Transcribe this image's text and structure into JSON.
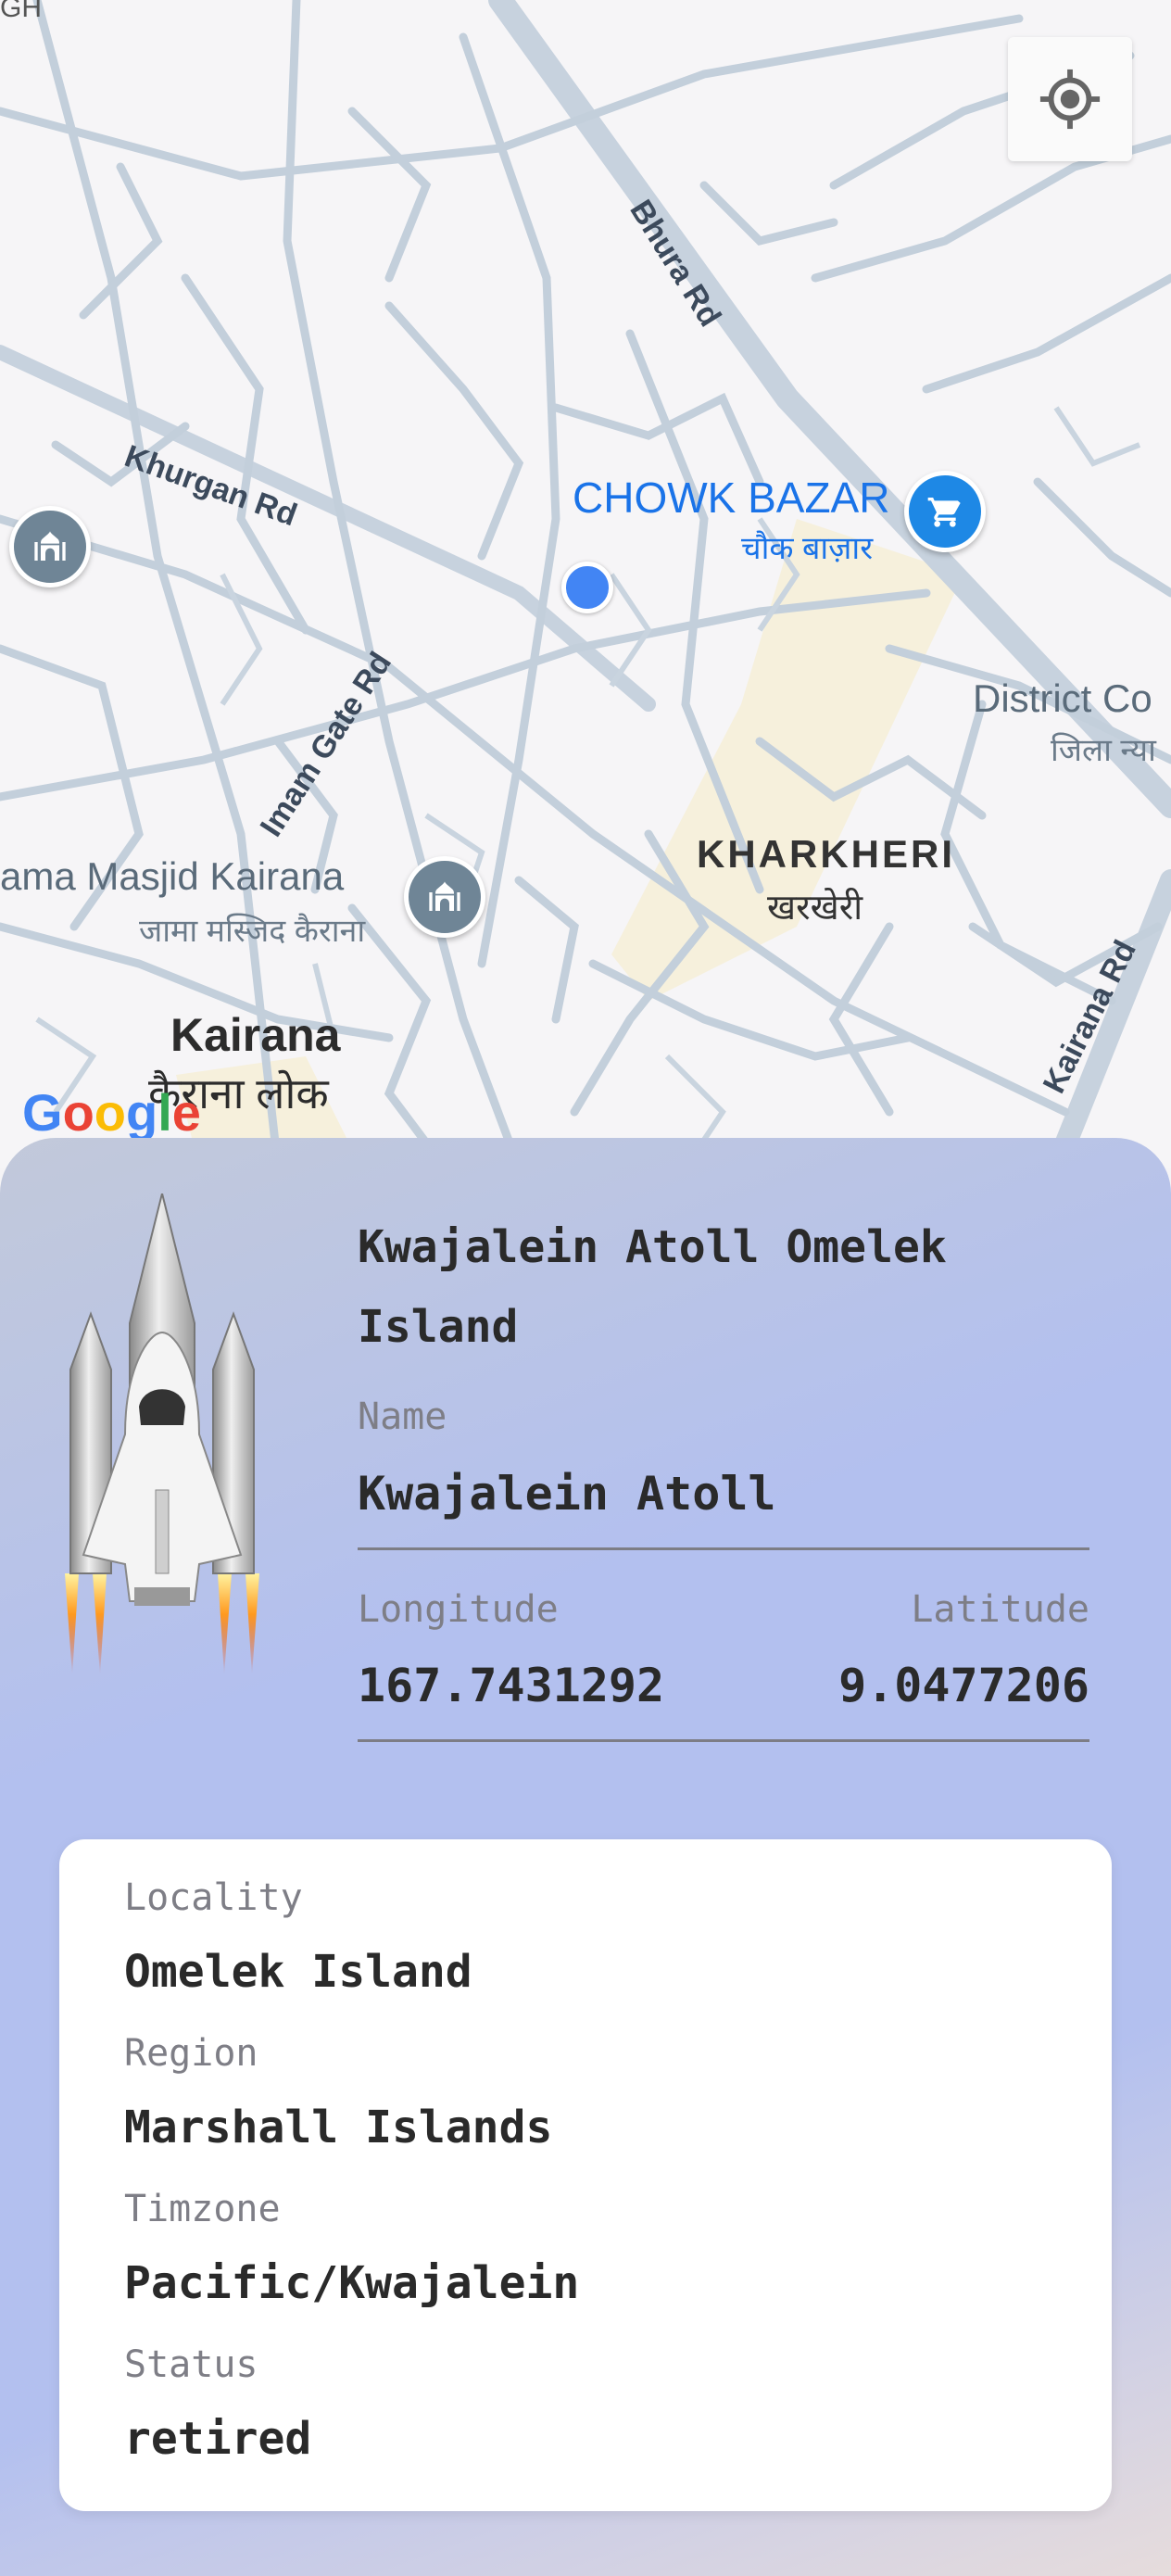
{
  "map": {
    "labels": {
      "top_left_fragment": "GH",
      "bhura_rd": "Bhura Rd",
      "khurgan_rd": "Khurgan Rd",
      "imam_gate_rd": "Imam Gate Rd",
      "kairana_rd": "Kairana Rd",
      "chowk_bazar": "CHOWK BAZAR",
      "chowk_bazar_hi": "चौक बाज़ार",
      "district_court": "District Co",
      "district_court_hi": "जिला न्या",
      "kharkheri": "KHARKHERI",
      "kharkheri_hi": "खरखेरी",
      "jama_masjid": "ama Masjid Kairana",
      "jama_masjid_hi": "जामा मस्जिद कैराना",
      "kairana": "Kairana",
      "kairana_hi": "कैराना लोक"
    },
    "google_logo": "Google",
    "icons": [
      "my-location-icon",
      "mosque-icon",
      "shopping-cart-icon"
    ]
  },
  "panel": {
    "title": "Kwajalein Atoll Omelek Island",
    "name_label": "Name",
    "name_value": "Kwajalein Atoll",
    "longitude_label": "Longitude",
    "longitude_value": "167.7431292",
    "latitude_label": "Latitude",
    "latitude_value": "9.0477206",
    "details": {
      "locality_label": "Locality",
      "locality_value": "Omelek Island",
      "region_label": "Region",
      "region_value": "Marshall Islands",
      "timezone_label": "Timzone",
      "timezone_value": "Pacific/Kwajalein",
      "status_label": "Status",
      "status_value": "retired"
    }
  },
  "colors": {
    "accent_blue": "#1a73e8",
    "panel_gradient_mid": "#b3c0ef",
    "map_background": "#f6f5f7"
  }
}
